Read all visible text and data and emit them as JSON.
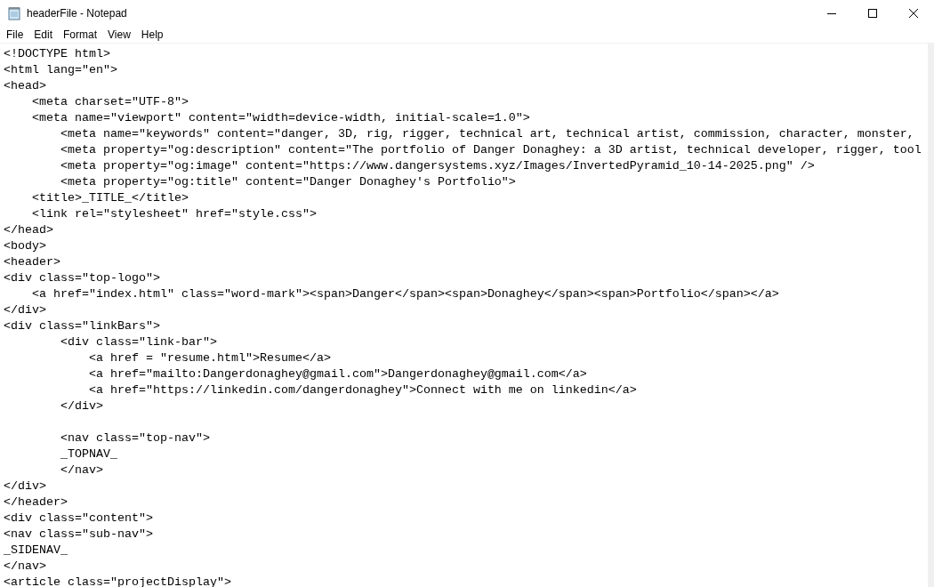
{
  "window": {
    "title": "headerFile - Notepad"
  },
  "menu": [
    {
      "label": "File"
    },
    {
      "label": "Edit"
    },
    {
      "label": "Format"
    },
    {
      "label": "View"
    },
    {
      "label": "Help"
    }
  ],
  "editor": {
    "lines": [
      {
        "kind": "code",
        "text": "<!DOCTYPE html>"
      },
      {
        "kind": "code",
        "text": "<html lang=\"en\">"
      },
      {
        "kind": "code",
        "text": "<head>"
      },
      {
        "kind": "code",
        "text": "    <meta charset=\"UTF-8\">"
      },
      {
        "kind": "code",
        "text": "    <meta name=\"viewport\" content=\"width=device-width, initial-scale=1.0\">"
      },
      {
        "kind": "code",
        "text": "        <meta name=\"keywords\" content=\"danger, 3D, rig, rigger, technical art, technical artist, commission, character, monster,"
      },
      {
        "kind": "code",
        "text": "        <meta property=\"og:description\" content=\"The portfolio of Danger Donaghey: a 3D artist, technical developer, rigger, tool"
      },
      {
        "kind": "code",
        "text": "        <meta property=\"og:image\" content=\"https://www.dangersystems.xyz/Images/InvertedPyramid_10-14-2025.png\" />"
      },
      {
        "kind": "code",
        "text": "        <meta property=\"og:title\" content=\"Danger Donaghey's Portfolio\">"
      },
      {
        "kind": "code",
        "text": "    <title>_TITLE_</title>"
      },
      {
        "kind": "code",
        "text": "    <link rel=\"stylesheet\" href=\"style.css\">"
      },
      {
        "kind": "code",
        "text": "</head>"
      },
      {
        "kind": "code",
        "text": "<body>"
      },
      {
        "kind": "code",
        "text": "<header>"
      },
      {
        "kind": "code",
        "text": "<div class=\"top-logo\">"
      },
      {
        "kind": "code",
        "text": "    <a href=\"index.html\" class=\"word-mark\"><span>Danger</span><span>Donaghey</span><span>Portfolio</span></a>"
      },
      {
        "kind": "code",
        "text": "</div>"
      },
      {
        "kind": "code",
        "text": "<div class=\"linkBars\">"
      },
      {
        "kind": "code",
        "text": "        <div class=\"link-bar\">"
      },
      {
        "kind": "code",
        "text": "            <a href = \"resume.html\">Resume</a>"
      },
      {
        "kind": "code",
        "text": "            <a href=\"mailto:Dangerdonaghey@gmail.com\">Dangerdonaghey@gmail.com</a>"
      },
      {
        "kind": "code",
        "text": "            <a href=\"https://linkedin.com/dangerdonaghey\">Connect with me on linkedin</a>"
      },
      {
        "kind": "code",
        "text": "        </div>"
      },
      {
        "kind": "blank"
      },
      {
        "kind": "code",
        "text": "        <nav class=\"top-nav\">"
      },
      {
        "kind": "code",
        "text": "        _TOPNAV_"
      },
      {
        "kind": "code",
        "text": "        </nav>"
      },
      {
        "kind": "code",
        "text": "</div>"
      },
      {
        "kind": "code",
        "text": "</header>"
      },
      {
        "kind": "code",
        "text": "<div class=\"content\">"
      },
      {
        "kind": "code",
        "text": "<nav class=\"sub-nav\">"
      },
      {
        "kind": "code",
        "text": "_SIDENAV_"
      },
      {
        "kind": "code",
        "text": "</nav>"
      },
      {
        "kind": "code",
        "text": "<article class=\"projectDisplay\">"
      }
    ]
  }
}
